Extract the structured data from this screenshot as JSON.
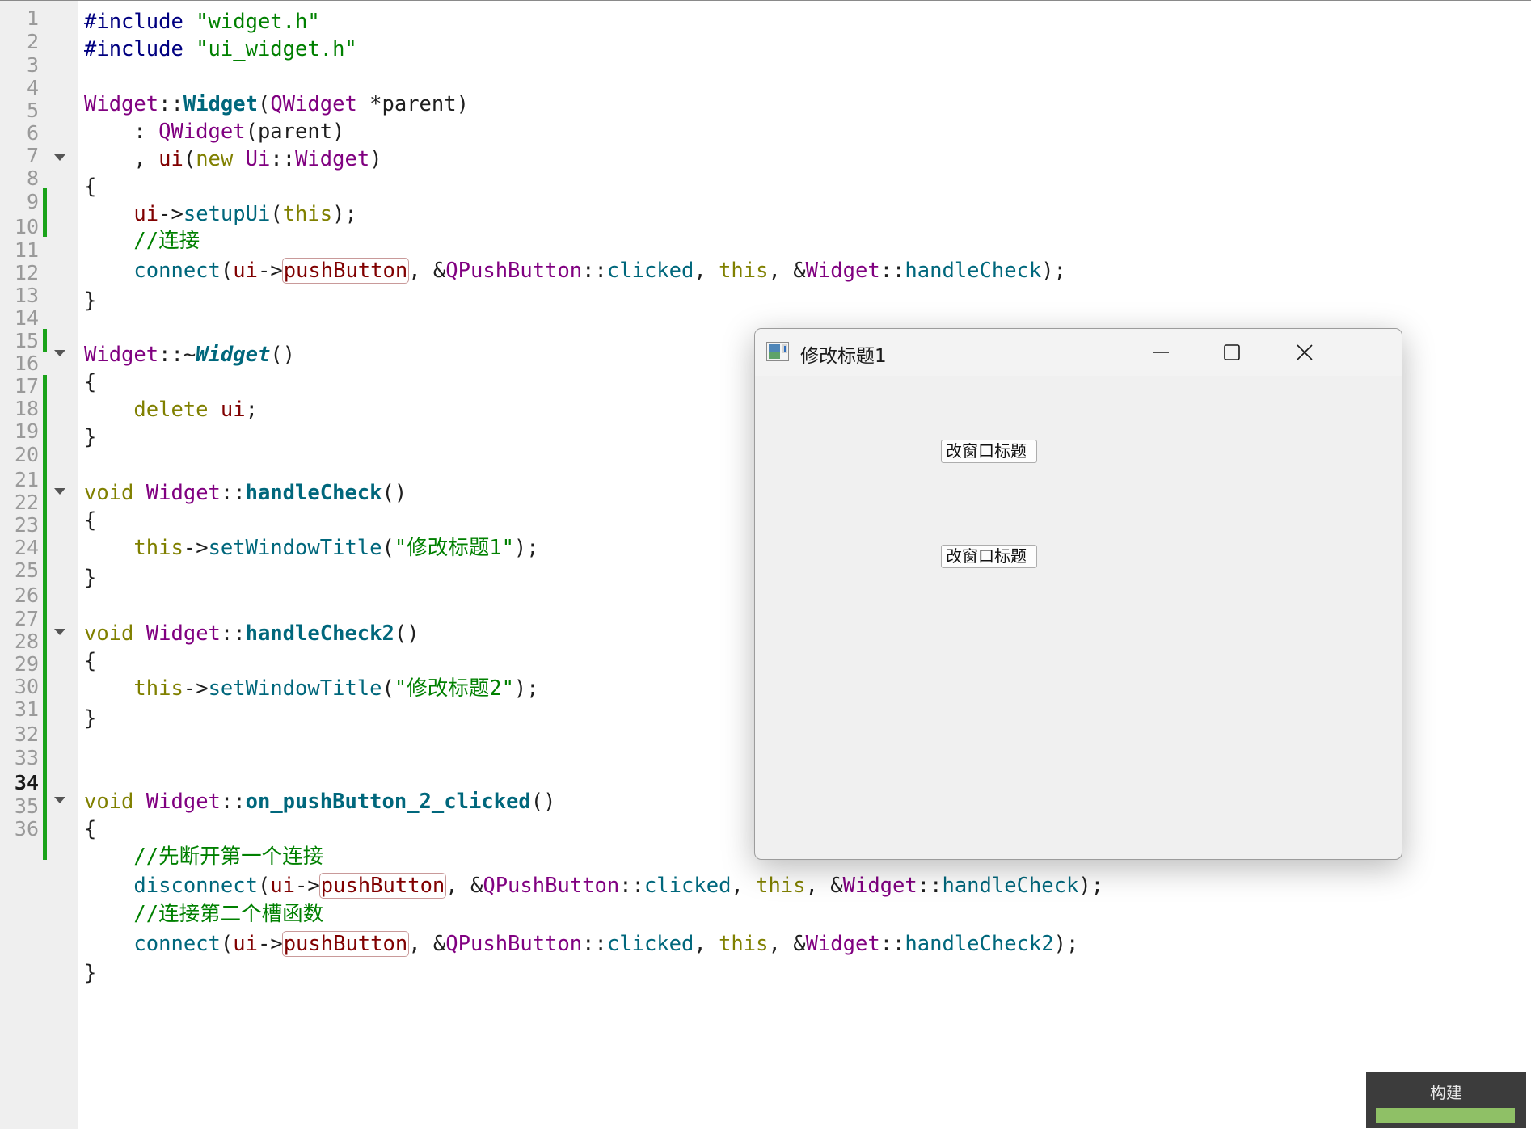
{
  "editor": {
    "line_numbers": [
      "1",
      "2",
      "3",
      "4",
      "5",
      "6",
      "7",
      "8",
      "9",
      "10",
      "11",
      "12",
      "13",
      "14",
      "15",
      "16",
      "17",
      "18",
      "19",
      "20",
      "21",
      "22",
      "23",
      "24",
      "25",
      "26",
      "27",
      "28",
      "29",
      "30",
      "31",
      "32",
      "33",
      "34",
      "35",
      "36"
    ],
    "current_line": 34,
    "folded_lines": [
      6,
      13,
      18,
      23,
      29
    ],
    "tokens": {
      "l1_pp": "#include",
      "l1_sp": " ",
      "l1_str": "\"widget.h\"",
      "l2_pp": "#include",
      "l2_sp": " ",
      "l2_str": "\"ui_widget.h\"",
      "l4_cls": "Widget",
      "l4_sep": "::",
      "l4_ctor": "Widget",
      "l4_p1": "(",
      "l4_type": "QWidget",
      "l4_rest": " *parent)",
      "l5_lead": "    : ",
      "l5_type": "QWidget",
      "l5_rest": "(parent)",
      "l6_lead": "    , ",
      "l6_member": "ui",
      "l6_p1": "(",
      "l6_kw": "new",
      "l6_sp": " ",
      "l6_ns": "Ui",
      "l6_sep": "::",
      "l6_cls": "Widget",
      "l6_p2": ")",
      "l7": "{",
      "l8_lead": "    ",
      "l8_member": "ui",
      "l8_arrow": "->",
      "l8_fn": "setupUi",
      "l8_p1": "(",
      "l8_kw": "this",
      "l8_p2": ");",
      "l9_lead": "    ",
      "l9_cmt": "//连接",
      "l10_lead": "    ",
      "l10_fn": "connect",
      "l10_p1": "(",
      "l10_member": "ui",
      "l10_arrow": "->",
      "l10_ptr": "pushButton",
      "l10_c1": ", &",
      "l10_type": "QPushButton",
      "l10_sep": "::",
      "l10_sig": "clicked",
      "l10_c2": ", ",
      "l10_kw": "this",
      "l10_c3": ", &",
      "l10_cls": "Widget",
      "l10_sep2": "::",
      "l10_slot": "handleCheck",
      "l10_end": ");",
      "l11": "}",
      "l13_cls": "Widget",
      "l13_sep": "::~",
      "l13_dtor": "Widget",
      "l13_rest": "()",
      "l14": "{",
      "l15_lead": "    ",
      "l15_kw": "delete",
      "l15_sp": " ",
      "l15_member": "ui",
      "l15_end": ";",
      "l16": "}",
      "l18_kw": "void",
      "l18_sp": " ",
      "l18_cls": "Widget",
      "l18_sep": "::",
      "l18_def": "handleCheck",
      "l18_rest": "()",
      "l19": "{",
      "l20_lead": "    ",
      "l20_kw": "this",
      "l20_arrow": "->",
      "l20_fn": "setWindowTitle",
      "l20_p1": "(",
      "l20_str": "\"修改标题1\"",
      "l20_end": ");",
      "l21": "}",
      "l23_kw": "void",
      "l23_sp": " ",
      "l23_cls": "Widget",
      "l23_sep": "::",
      "l23_def": "handleCheck2",
      "l23_rest": "()",
      "l24": "{",
      "l25_lead": "    ",
      "l25_kw": "this",
      "l25_arrow": "->",
      "l25_fn": "setWindowTitle",
      "l25_p1": "(",
      "l25_str": "\"修改标题2\"",
      "l25_end": ");",
      "l26": "}",
      "l29_kw": "void",
      "l29_sp": " ",
      "l29_cls": "Widget",
      "l29_sep": "::",
      "l29_def": "on_pushButton_2_clicked",
      "l29_rest": "()",
      "l30": "{",
      "l31_lead": "    ",
      "l31_cmt": "//先断开第一个连接",
      "l32_lead": "    ",
      "l32_fn": "disconnect",
      "l32_p1": "(",
      "l32_member": "ui",
      "l32_arrow": "->",
      "l32_ptr": "pushButton",
      "l32_c1": ", &",
      "l32_type": "QPushButton",
      "l32_sep": "::",
      "l32_sig": "clicked",
      "l32_c2": ", ",
      "l32_kw": "this",
      "l32_c3": ", &",
      "l32_cls": "Widget",
      "l32_sep2": "::",
      "l32_slot": "handleCheck",
      "l32_end": ");",
      "l33_lead": "    ",
      "l33_cmt": "//连接第二个槽函数",
      "l34_lead": "    ",
      "l34_fn": "connect",
      "l34_p1": "(",
      "l34_member": "ui",
      "l34_arrow": "->",
      "l34_ptr": "pushButton",
      "l34_c1": ", &",
      "l34_type": "QPushButton",
      "l34_sep": "::",
      "l34_sig": "clicked",
      "l34_c2": ", ",
      "l34_kw": "this",
      "l34_c3": ", &",
      "l34_cls": "Widget",
      "l34_sep2": "::",
      "l34_slot": "handleCheck2",
      "l34_end": ");",
      "l35": "}"
    }
  },
  "app_window": {
    "title": "修改标题1",
    "icon": "qt-app-icon",
    "controls": {
      "minimize": "minimize-icon",
      "maximize": "maximize-icon",
      "close": "close-icon"
    },
    "buttons": [
      "改窗口标题",
      "改窗口标题"
    ]
  },
  "build": {
    "label": "构建",
    "progress": 1.0
  },
  "colors": {
    "change_bar": "#1aa31a",
    "build_progress": "#8fc066"
  }
}
